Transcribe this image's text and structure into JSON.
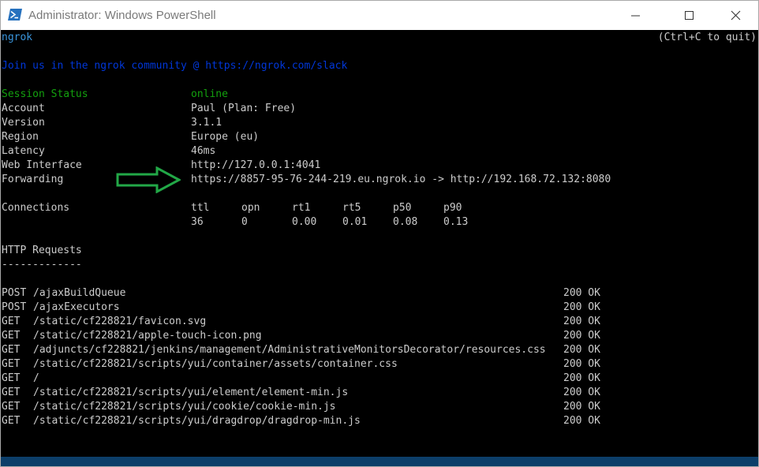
{
  "window": {
    "title": "Administrator: Windows PowerShell",
    "icon": "powershell-icon",
    "controls": [
      "minimize-icon",
      "maximize-icon",
      "close-icon"
    ]
  },
  "colors": {
    "console_bg": "#000000",
    "text": "#cccccc",
    "ngrok_title": "#3a96dd",
    "join": "#0037da",
    "online": "#13a10e",
    "arrow": "#22a847",
    "statusbar": "#0c3e69"
  },
  "header": {
    "app": "ngrok",
    "quit_hint": "(Ctrl+C to quit)",
    "join": "Join us in the ngrok community @ https://ngrok.com/slack"
  },
  "session": {
    "status_label": "Session Status",
    "status_value": "online",
    "account_label": "Account",
    "account_value": "Paul (Plan: Free)",
    "version_label": "Version",
    "version_value": "3.1.1",
    "region_label": "Region",
    "region_value": "Europe (eu)",
    "latency_label": "Latency",
    "latency_value": "46ms",
    "web_label": "Web Interface",
    "web_value": "http://127.0.0.1:4041",
    "forwarding_label": "Forwarding",
    "forwarding_value": "https://8857-95-76-244-219.eu.ngrok.io -> http://192.168.72.132:8080"
  },
  "connections": {
    "label": "Connections",
    "headers": [
      "ttl",
      "opn",
      "rt1",
      "rt5",
      "p50",
      "p90"
    ],
    "values": [
      "36",
      "0",
      "0.00",
      "0.01",
      "0.08",
      "0.13"
    ]
  },
  "http": {
    "title": "HTTP Requests",
    "divider": "-------------",
    "requests": [
      {
        "method": "POST",
        "path": "/ajaxBuildQueue",
        "status": "200 OK"
      },
      {
        "method": "POST",
        "path": "/ajaxExecutors",
        "status": "200 OK"
      },
      {
        "method": "GET",
        "path": "/static/cf228821/favicon.svg",
        "status": "200 OK"
      },
      {
        "method": "GET",
        "path": "/static/cf228821/apple-touch-icon.png",
        "status": "200 OK"
      },
      {
        "method": "GET",
        "path": "/adjuncts/cf228821/jenkins/management/AdministrativeMonitorsDecorator/resources.css",
        "status": "200 OK"
      },
      {
        "method": "GET",
        "path": "/static/cf228821/scripts/yui/container/assets/container.css",
        "status": "200 OK"
      },
      {
        "method": "GET",
        "path": "/",
        "status": "200 OK"
      },
      {
        "method": "GET",
        "path": "/static/cf228821/scripts/yui/element/element-min.js",
        "status": "200 OK"
      },
      {
        "method": "GET",
        "path": "/static/cf228821/scripts/yui/cookie/cookie-min.js",
        "status": "200 OK"
      },
      {
        "method": "GET",
        "path": "/static/cf228821/scripts/yui/dragdrop/dragdrop-min.js",
        "status": "200 OK"
      }
    ]
  }
}
